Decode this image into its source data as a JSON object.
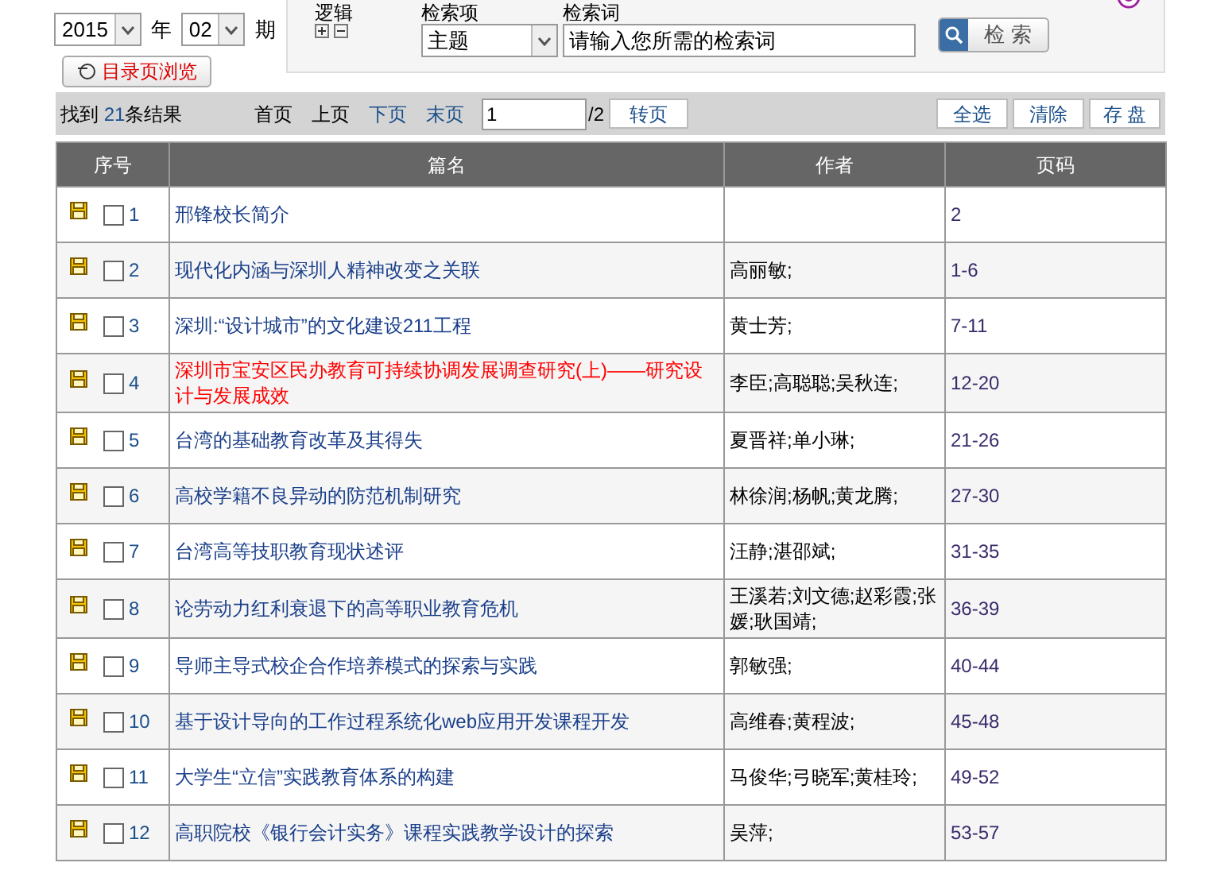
{
  "issue_filter": {
    "year": "2015",
    "year_label": "年",
    "issue": "02",
    "issue_label": "期",
    "browse_button": "目录页浏览"
  },
  "search_panel": {
    "logic_label": "逻辑",
    "field_label": "检索项",
    "term_label": "检索词",
    "field_value": "主题",
    "placeholder": "请输入您所需的检索词",
    "search_button": "检 索"
  },
  "toolbar": {
    "found_prefix": "找到",
    "count": "21",
    "found_suffix": "条结果",
    "pager": [
      {
        "label": "首页",
        "disabled": true
      },
      {
        "label": "上页",
        "disabled": true
      },
      {
        "label": "下页",
        "disabled": false
      },
      {
        "label": "末页",
        "disabled": false
      }
    ],
    "page_value": "1",
    "page_total": "/2",
    "go_button": "转页",
    "actions": [
      "全选",
      "清除",
      "存 盘"
    ]
  },
  "table": {
    "columns": [
      "序号",
      "篇名",
      "作者",
      "页码"
    ],
    "rows": [
      {
        "no": "1",
        "checked": false,
        "highlighted": false,
        "title": "邢锋校长简介",
        "authors": "",
        "pages": "2"
      },
      {
        "no": "2",
        "checked": false,
        "highlighted": false,
        "title": "现代化内涵与深圳人精神改变之关联",
        "authors": "高丽敏;",
        "pages": "1-6"
      },
      {
        "no": "3",
        "checked": false,
        "highlighted": false,
        "title": "深圳:“设计城市”的文化建设211工程",
        "authors": "黄士芳;",
        "pages": "7-11"
      },
      {
        "no": "4",
        "checked": false,
        "highlighted": true,
        "title": "深圳市宝安区民办教育可持续协调发展调查研究(上)——研究设计与发展成效",
        "authors": "李臣;高聪聪;吴秋连;",
        "pages": "12-20"
      },
      {
        "no": "5",
        "checked": false,
        "highlighted": false,
        "title": "台湾的基础教育改革及其得失",
        "authors": "夏晋祥;单小琳;",
        "pages": "21-26"
      },
      {
        "no": "6",
        "checked": false,
        "highlighted": false,
        "title": "高校学籍不良异动的防范机制研究",
        "authors": "林徐润;杨帆;黄龙腾;",
        "pages": "27-30"
      },
      {
        "no": "7",
        "checked": false,
        "highlighted": false,
        "title": "台湾高等技职教育现状述评",
        "authors": "汪静;湛邵斌;",
        "pages": "31-35"
      },
      {
        "no": "8",
        "checked": false,
        "highlighted": false,
        "title": "论劳动力红利衰退下的高等职业教育危机",
        "authors": "王溪若;刘文德;赵彩霞;张媛;耿国靖;",
        "pages": "36-39"
      },
      {
        "no": "9",
        "checked": false,
        "highlighted": false,
        "title": "导师主导式校企合作培养模式的探索与实践",
        "authors": "郭敏强;",
        "pages": "40-44"
      },
      {
        "no": "10",
        "checked": false,
        "highlighted": false,
        "title": "基于设计导向的工作过程系统化web应用开发课程开发",
        "authors": "高维春;黄程波;",
        "pages": "45-48"
      },
      {
        "no": "11",
        "checked": false,
        "highlighted": false,
        "title": "大学生“立信”实践教育体系的构建",
        "authors": "马俊华;弓晓军;黄桂玲;",
        "pages": "49-52"
      },
      {
        "no": "12",
        "checked": false,
        "highlighted": false,
        "title": "高职院校《银行会计实务》课程实践教学设计的探索",
        "authors": "吴萍;",
        "pages": "53-57"
      }
    ]
  }
}
